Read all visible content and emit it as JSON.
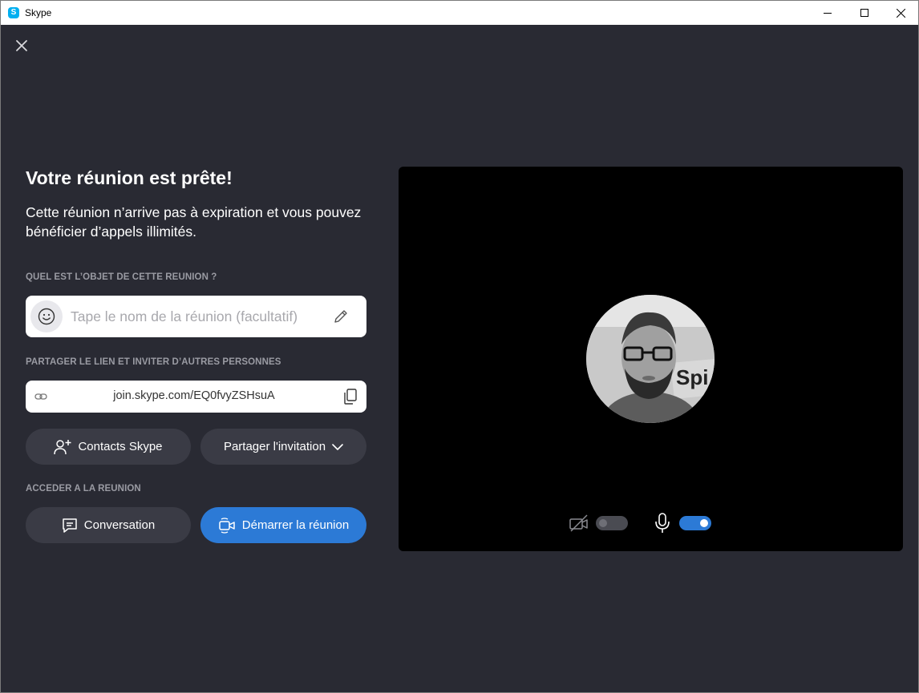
{
  "window": {
    "title": "Skype",
    "logo_letter": "S",
    "colors": {
      "brand": "#00aff0"
    }
  },
  "meeting": {
    "heading": "Votre réunion est prête!",
    "description": "Cette réunion n’arrive pas à expiration et vous pouvez bénéficier d’appels illimités.",
    "subject_label": "QUEL EST L’OBJET DE CETTE REUNION ?",
    "subject_placeholder": "Tape le nom de la réunion (facultatif)",
    "subject_value": "",
    "share_label": "PARTAGER LE LIEN ET INVITER D’AUTRES PERSONNES",
    "link": "join.skype.com/EQ0fvyZSHsuA",
    "contacts_button": "Contacts Skype",
    "share_button": "Partager l'invitation",
    "join_label": "ACCEDER A LA REUNION",
    "conversation_button": "Conversation",
    "start_button": "Démarrer la réunion"
  },
  "preview": {
    "camera_on": false,
    "microphone_on": true,
    "colors": {
      "accent": "#2c7ad6",
      "background": "#292a33"
    }
  },
  "icons": [
    "close-icon",
    "smiley-icon",
    "pencil-icon",
    "link-icon",
    "copy-icon",
    "add-contact-icon",
    "chevron-down-icon",
    "chat-icon",
    "video-camera-icon",
    "camera-off-icon",
    "microphone-icon"
  ]
}
